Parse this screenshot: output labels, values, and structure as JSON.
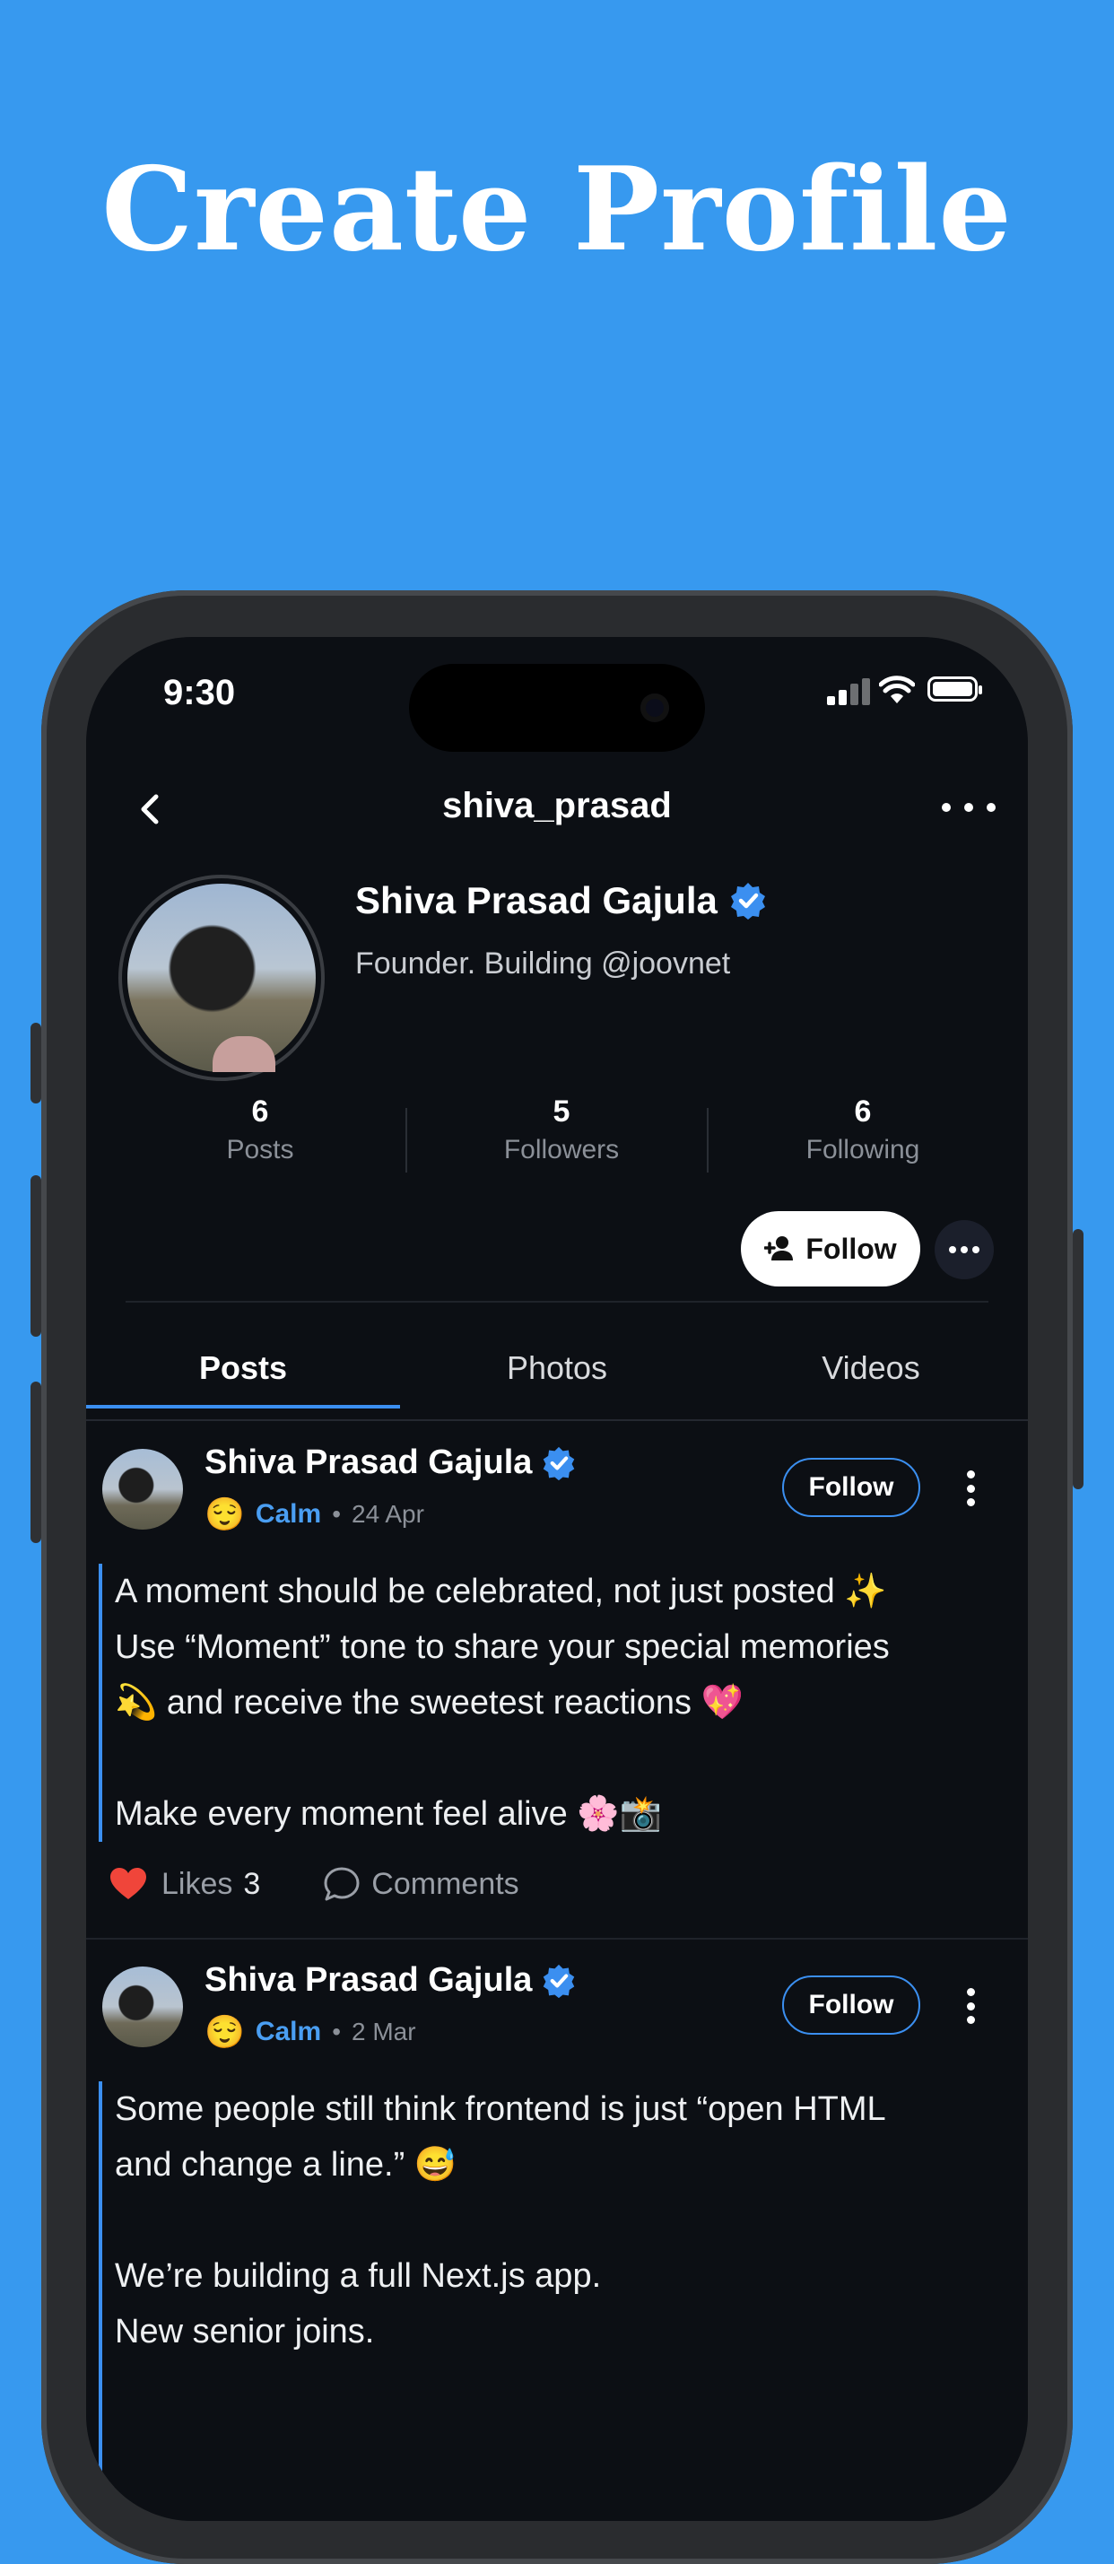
{
  "promo": {
    "title": "Create Profile"
  },
  "status_bar": {
    "time": "9:30"
  },
  "nav": {
    "title": "shiva_prasad"
  },
  "profile": {
    "name": "Shiva Prasad Gajula",
    "bio": "Founder. Building @joovnet",
    "stats": [
      {
        "value": "6",
        "label": "Posts"
      },
      {
        "value": "5",
        "label": "Followers"
      },
      {
        "value": "6",
        "label": "Following"
      }
    ],
    "follow_label": "Follow"
  },
  "tabs": [
    {
      "label": "Posts"
    },
    {
      "label": "Photos"
    },
    {
      "label": "Videos"
    }
  ],
  "posts": [
    {
      "author": "Shiva Prasad Gajula",
      "mood_emoji": "😌",
      "tone": "Calm",
      "separator": "•",
      "date": "24 Apr",
      "follow_label": "Follow",
      "body": "A moment should be celebrated, not just posted ✨\nUse “Moment” tone to share your special memories\n💫 and receive the sweetest reactions 💖\n\nMake every moment feel alive 🌸📸",
      "likes_label": "Likes",
      "likes_count": "3",
      "comments_label": "Comments"
    },
    {
      "author": "Shiva Prasad Gajula",
      "mood_emoji": "😌",
      "tone": "Calm",
      "separator": "•",
      "date": "2 Mar",
      "follow_label": "Follow",
      "body": "Some people still think frontend is just “open HTML\nand change a line.” 😅\n\nWe’re building a full Next.js app.\nNew senior joins."
    }
  ],
  "colors": {
    "background": "#3799ef",
    "screen": "#0c0f14",
    "accent": "#3b8ff0",
    "like": "#f0453a"
  }
}
